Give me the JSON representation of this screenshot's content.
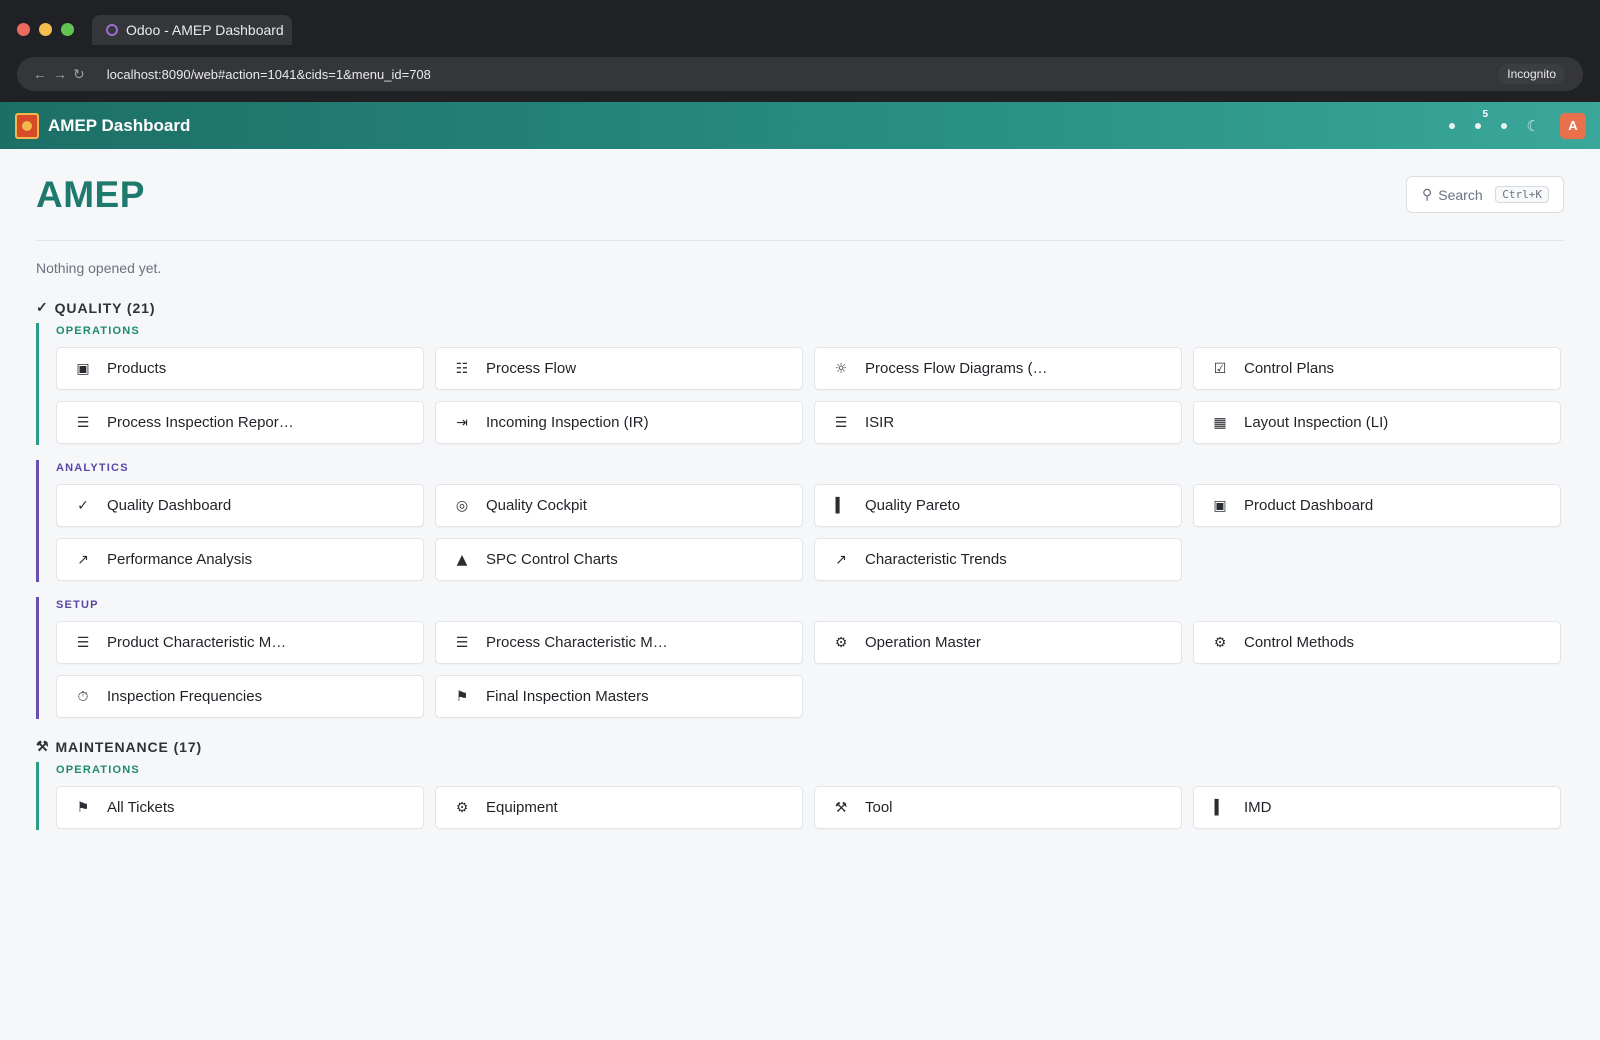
{
  "browser": {
    "tab_title": "Odoo - AMEP Dashboard",
    "url": "localhost:8090/web#action=1041&cids=1&menu_id=708",
    "incognito_label": "Incognito",
    "nav": {
      "back": "←",
      "forward": "→",
      "reload": "↻"
    }
  },
  "header": {
    "app_title": "AMEP Dashboard",
    "notification_count": "5",
    "theme_icon": "☾",
    "avatar_letter": "A"
  },
  "page": {
    "title": "AMEP",
    "search_placeholder": "Search",
    "search_shortcut": "Ctrl+K",
    "empty_message": "Nothing opened yet."
  },
  "sections": {
    "quality": {
      "icon": "✓",
      "title": "QUALITY (21)",
      "operations": {
        "title": "OPERATIONS",
        "items": [
          {
            "icon": "▣",
            "label": "Products"
          },
          {
            "icon": "☷",
            "label": "Process Flow"
          },
          {
            "icon": "☼",
            "label": "Process Flow Diagrams (…"
          },
          {
            "icon": "☑",
            "label": "Control Plans"
          },
          {
            "icon": "☰",
            "label": "Process Inspection Repor…"
          },
          {
            "icon": "⇥",
            "label": "Incoming Inspection (IR)"
          },
          {
            "icon": "☰",
            "label": "ISIR"
          },
          {
            "icon": "▦",
            "label": "Layout Inspection (LI)"
          }
        ]
      },
      "analytics": {
        "title": "ANALYTICS",
        "items": [
          {
            "icon": "✓",
            "label": "Quality Dashboard"
          },
          {
            "icon": "◎",
            "label": "Quality Cockpit"
          },
          {
            "icon": "▍",
            "label": "Quality Pareto"
          },
          {
            "icon": "▣",
            "label": "Product Dashboard"
          },
          {
            "icon": "↗",
            "label": "Performance Analysis"
          },
          {
            "icon": "▲",
            "label": "SPC Control Charts"
          },
          {
            "icon": "↗",
            "label": "Characteristic Trends"
          }
        ]
      },
      "setup": {
        "title": "SETUP",
        "items": [
          {
            "icon": "☰",
            "label": "Product Characteristic M…"
          },
          {
            "icon": "☰",
            "label": "Process Characteristic M…"
          },
          {
            "icon": "⚙",
            "label": "Operation Master"
          },
          {
            "icon": "⚙",
            "label": "Control Methods"
          },
          {
            "icon": "⏱",
            "label": "Inspection Frequencies"
          },
          {
            "icon": "⚑",
            "label": "Final Inspection Masters"
          }
        ]
      }
    },
    "maintenance": {
      "icon": "⚒",
      "title": "MAINTENANCE (17)",
      "operations": {
        "title": "OPERATIONS",
        "items": [
          {
            "icon": "⚑",
            "label": "All Tickets"
          },
          {
            "icon": "⚙",
            "label": "Equipment"
          },
          {
            "icon": "⚒",
            "label": "Tool"
          },
          {
            "icon": "▍",
            "label": "IMD"
          }
        ]
      }
    }
  }
}
